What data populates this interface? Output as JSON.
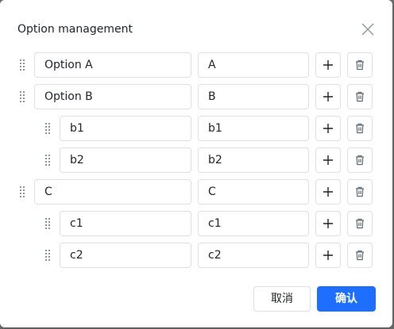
{
  "dialog": {
    "title": "Option management",
    "close_icon": "close-icon"
  },
  "options": [
    {
      "id": "option-a",
      "label": "Option A",
      "value": "A",
      "level": 0
    },
    {
      "id": "option-b",
      "label": "Option B",
      "value": "B",
      "level": 0
    },
    {
      "id": "b1",
      "label": "b1",
      "value": "b1",
      "level": 1
    },
    {
      "id": "b2",
      "label": "b2",
      "value": "b2",
      "level": 1
    },
    {
      "id": "c",
      "label": "C",
      "value": "C",
      "level": 0
    },
    {
      "id": "c1",
      "label": "c1",
      "value": "c1",
      "level": 1
    },
    {
      "id": "c2",
      "label": "c2",
      "value": "c2",
      "level": 1
    }
  ],
  "icons": {
    "drag": "drag-handle-icon",
    "add": "plus-icon",
    "delete": "trash-icon"
  },
  "footer": {
    "cancel_label": "取消",
    "confirm_label": "确认"
  },
  "colors": {
    "primary": "#1e6fff",
    "border": "#dcdfe6",
    "text": "#1f2329",
    "icon": "#646a73"
  }
}
